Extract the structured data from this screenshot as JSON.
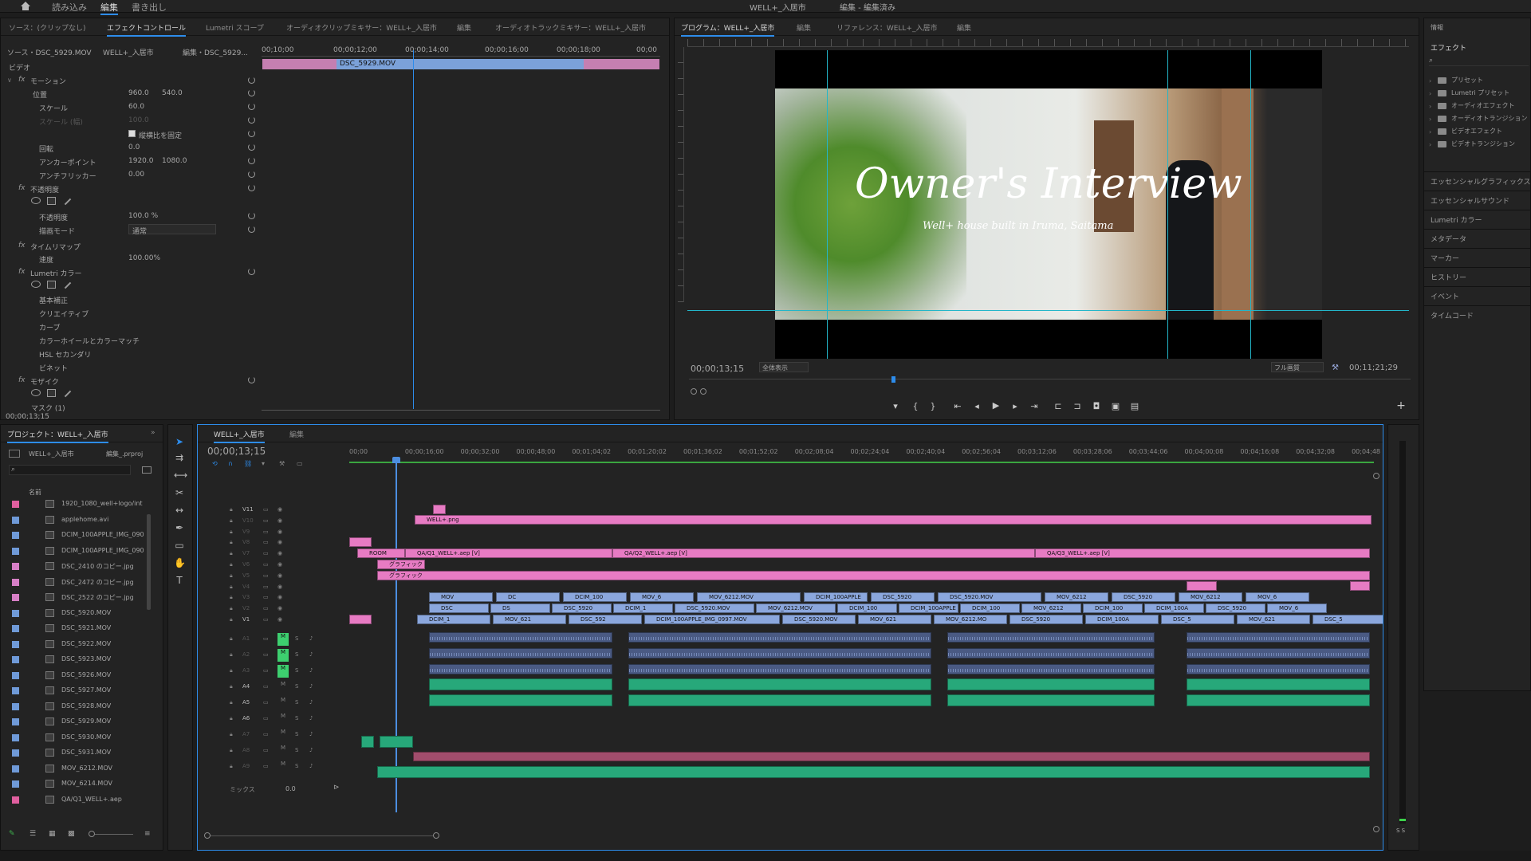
{
  "workspaces": {
    "tab1": "読み込み",
    "tab2": "編集",
    "tab3": "書き出し"
  },
  "app_title": "WELL+_入居市",
  "app_subtitle": "編集 - 編集済み",
  "source_panel": {
    "tab_source": "ソース：(クリップなし)",
    "tab_effect_controls": "エフェクトコントロール",
    "tab_lumetri_scope": "Lumetri スコープ",
    "tab_audio_clip_mixer": "オーディオクリップミキサー：WELL+_入居市",
    "tab_edit": "編集",
    "tab_audio_track_mixer": "オーディオトラックミキサー：WELL+_入居市"
  },
  "effect_controls": {
    "source_label": "ソース・DSC_5929.MOV",
    "sequence_label": "WELL+_入居市",
    "clip_label": "編集・DSC_5929...",
    "video_heading": "ビデオ",
    "ruler_times": [
      "00;10;00",
      "00;00;12;00",
      "00;00;14;00",
      "00;00;16;00",
      "00;00;18;00",
      "00;00"
    ],
    "clip_name": "DSC_5929.MOV",
    "motion": "モーション",
    "position": "位置",
    "position_x": "960.0",
    "position_y": "540.0",
    "scale": "スケール",
    "scale_val": "60.0",
    "scale_width": "スケール (幅)",
    "scale_width_val": "100.0",
    "uniform_scale": "縦横比を固定",
    "rotation": "回転",
    "rotation_val": "0.0",
    "anchor": "アンカーポイント",
    "anchor_x": "1920.0",
    "anchor_y": "1080.0",
    "antiflicker": "アンチフリッカー",
    "antiflicker_val": "0.00",
    "opacity": "不透明度",
    "opacity_inner": "不透明度",
    "opacity_val": "100.0 %",
    "blend_mode": "描画モード",
    "blend_val": "通常",
    "time_remap": "タイムリマップ",
    "speed": "速度",
    "speed_val": "100.00%",
    "lumetri": "Lumetri カラー",
    "basic": "基本補正",
    "creative": "クリエイティブ",
    "curves": "カーブ",
    "color_wheels": "カラーホイールとカラーマッチ",
    "hsl": "HSL セカンダリ",
    "vignette": "ビネット",
    "mosaic": "モザイク",
    "mask": "マスク (1)",
    "timecode": "00;00;13;15"
  },
  "program": {
    "tab_program": "プログラム：WELL+_入居市",
    "tab_edit": "編集",
    "tab_reference": "リファレンス：WELL+_入居市",
    "tab_edit2": "編集",
    "title_overlay": "Owner's Interview",
    "subtitle_overlay": "Well+ house built in Iruma, Saitama",
    "timecode": "00;00;13;15",
    "fit": "全体表示",
    "quality": "フル画質",
    "duration": "00;11;21;29"
  },
  "right_panel": {
    "tab_info": "情報",
    "tab_effects": "エフェクト",
    "items": [
      "プリセット",
      "Lumetri プリセット",
      "オーディオエフェクト",
      "オーディオトランジション",
      "ビデオエフェクト",
      "ビデオトランジション"
    ],
    "sections": [
      "エッセンシャルグラフィックス",
      "エッセンシャルサウンド",
      "Lumetri カラー",
      "メタデータ",
      "マーカー",
      "ヒストリー",
      "イベント",
      "タイムコード"
    ]
  },
  "project": {
    "tab": "プロジェクト：WELL+_入居市",
    "bin": "WELL+_入居市",
    "bin2": "編集_.prproj",
    "col_name": "名前",
    "items": [
      {
        "name": "1920_1080_well+logo/int",
        "color": "#e05f9f"
      },
      {
        "name": "applehome.avi",
        "color": "#6f9ad8"
      },
      {
        "name": "DCIM_100APPLE_IMG_090",
        "color": "#6f9ad8"
      },
      {
        "name": "DCIM_100APPLE_IMG_090",
        "color": "#6f9ad8"
      },
      {
        "name": "DSC_2410 のコピー.jpg",
        "color": "#d77fc6"
      },
      {
        "name": "DSC_2472 のコピー.jpg",
        "color": "#d77fc6"
      },
      {
        "name": "DSC_2522 のコピー.jpg",
        "color": "#d77fc6"
      },
      {
        "name": "DSC_5920.MOV",
        "color": "#6f9ad8"
      },
      {
        "name": "DSC_5921.MOV",
        "color": "#6f9ad8"
      },
      {
        "name": "DSC_5922.MOV",
        "color": "#6f9ad8"
      },
      {
        "name": "DSC_5923.MOV",
        "color": "#6f9ad8"
      },
      {
        "name": "DSC_5926.MOV",
        "color": "#6f9ad8"
      },
      {
        "name": "DSC_5927.MOV",
        "color": "#6f9ad8"
      },
      {
        "name": "DSC_5928.MOV",
        "color": "#6f9ad8"
      },
      {
        "name": "DSC_5929.MOV",
        "color": "#6f9ad8"
      },
      {
        "name": "DSC_5930.MOV",
        "color": "#6f9ad8"
      },
      {
        "name": "DSC_5931.MOV",
        "color": "#6f9ad8"
      },
      {
        "name": "MOV_6212.MOV",
        "color": "#6f9ad8"
      },
      {
        "name": "MOV_6214.MOV",
        "color": "#6f9ad8"
      },
      {
        "name": "QA/Q1_WELL+.aep",
        "color": "#e05f9f"
      }
    ]
  },
  "timeline": {
    "tab": "WELL+_入居市",
    "tab2": "編集",
    "timecode": "00;00;13;15",
    "ruler": [
      "00;00",
      "00;00;16;00",
      "00;00;32;00",
      "00;00;48;00",
      "00;01;04;02",
      "00;01;20;02",
      "00;01;36;02",
      "00;01;52;02",
      "00;02;08;04",
      "00;02;24;04",
      "00;02;40;04",
      "00;02;56;04",
      "00;03;12;06",
      "00;03;28;06",
      "00;03;44;06",
      "00;04;00;08",
      "00;04;16;08",
      "00;04;32;08",
      "00;04;48"
    ],
    "video_tracks": [
      "V11",
      "V10",
      "V9",
      "V8",
      "V7",
      "V6",
      "V5",
      "V4",
      "V3",
      "V2",
      "V1"
    ],
    "audio_tracks": [
      "A1",
      "A2",
      "A3",
      "A4",
      "A5",
      "A6",
      "A7",
      "A8",
      "A9"
    ],
    "mix_label": "ミックス",
    "mix_val": "0.0",
    "clip_logo": "WELL+.png",
    "clip_room": "ROOM",
    "clip_qa1": "QA/Q1_WELL+.aep [V]",
    "clip_qa2": "QA/Q2_WELL+.aep [V]",
    "clip_qa3": "QA/Q3_WELL+.aep [V]",
    "clip_graphic": "グラフィック",
    "v3_clips": [
      "MOV",
      "DC",
      "DCIM_100",
      "MOV_6",
      "MOV_6212.MOV",
      "DCIM_100APPLE",
      "DSC_5920",
      "DSC_5920.MOV",
      "MOV_6212",
      "DSC_5920",
      "MOV_6212",
      "MOV_6"
    ],
    "v2_clips": [
      "DSC",
      "DS",
      "DSC_5920",
      "DCIM_1",
      "DSC_5920.MOV",
      "MOV_6212.MOV",
      "DCIM_100",
      "DCIM_100APPLE",
      "DCIM_100",
      "MOV_6212",
      "DCIM_100",
      "DCIM_100A",
      "DSC_5920",
      "MOV_6"
    ],
    "v1_clips": [
      "DCIM_1",
      "MOV_621",
      "DSC_592",
      "DCIM_100APPLE_IMG_0997.MOV",
      "DSC_5920.MOV",
      "MOV_621",
      "MOV_6212.MO",
      "DSC_5920",
      "DCIM_100A",
      "DSC_5",
      "MOV_621",
      "DSC_5"
    ],
    "meter_label": "S S"
  }
}
